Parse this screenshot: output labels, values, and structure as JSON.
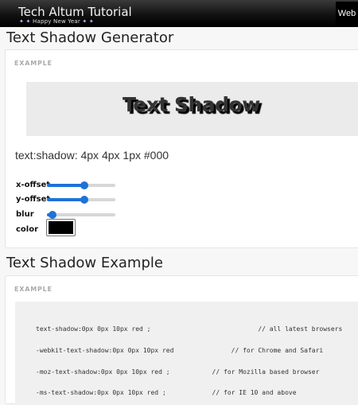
{
  "header": {
    "title": "Tech Altum Tutorial",
    "subtitle": "Happy New Year",
    "nav_item": "Web"
  },
  "generator": {
    "heading": "Text Shadow Generator",
    "label": "EXAMPLE",
    "preview_text": "Text Shadow",
    "css_output": "text:shadow: 4px 4px 1px #000",
    "controls": {
      "x_offset": {
        "label": "x-offset",
        "value": 0.55
      },
      "y_offset": {
        "label": "y-offset",
        "value": 0.55
      },
      "blur": {
        "label": "blur",
        "value": 0.08
      },
      "color": {
        "label": "color",
        "value": "#000000"
      }
    }
  },
  "example": {
    "heading": "Text Shadow Example",
    "label": "EXAMPLE",
    "code_lines": [
      "text-shadow:0px 0px 10px red ;                            // all latest browsers",
      "-webkit-text-shadow:0px 0px 10px red               // for Chrome and Safari",
      "-moz-text-shadow:0px 0px 10px red ;           // for Mozilla based browser",
      "-ms-text-shadow:0px 0px 10px red ;            // for IE 10 and above"
    ]
  },
  "colors": {
    "accent": "#1e72d8",
    "header_bg": "#000000"
  }
}
